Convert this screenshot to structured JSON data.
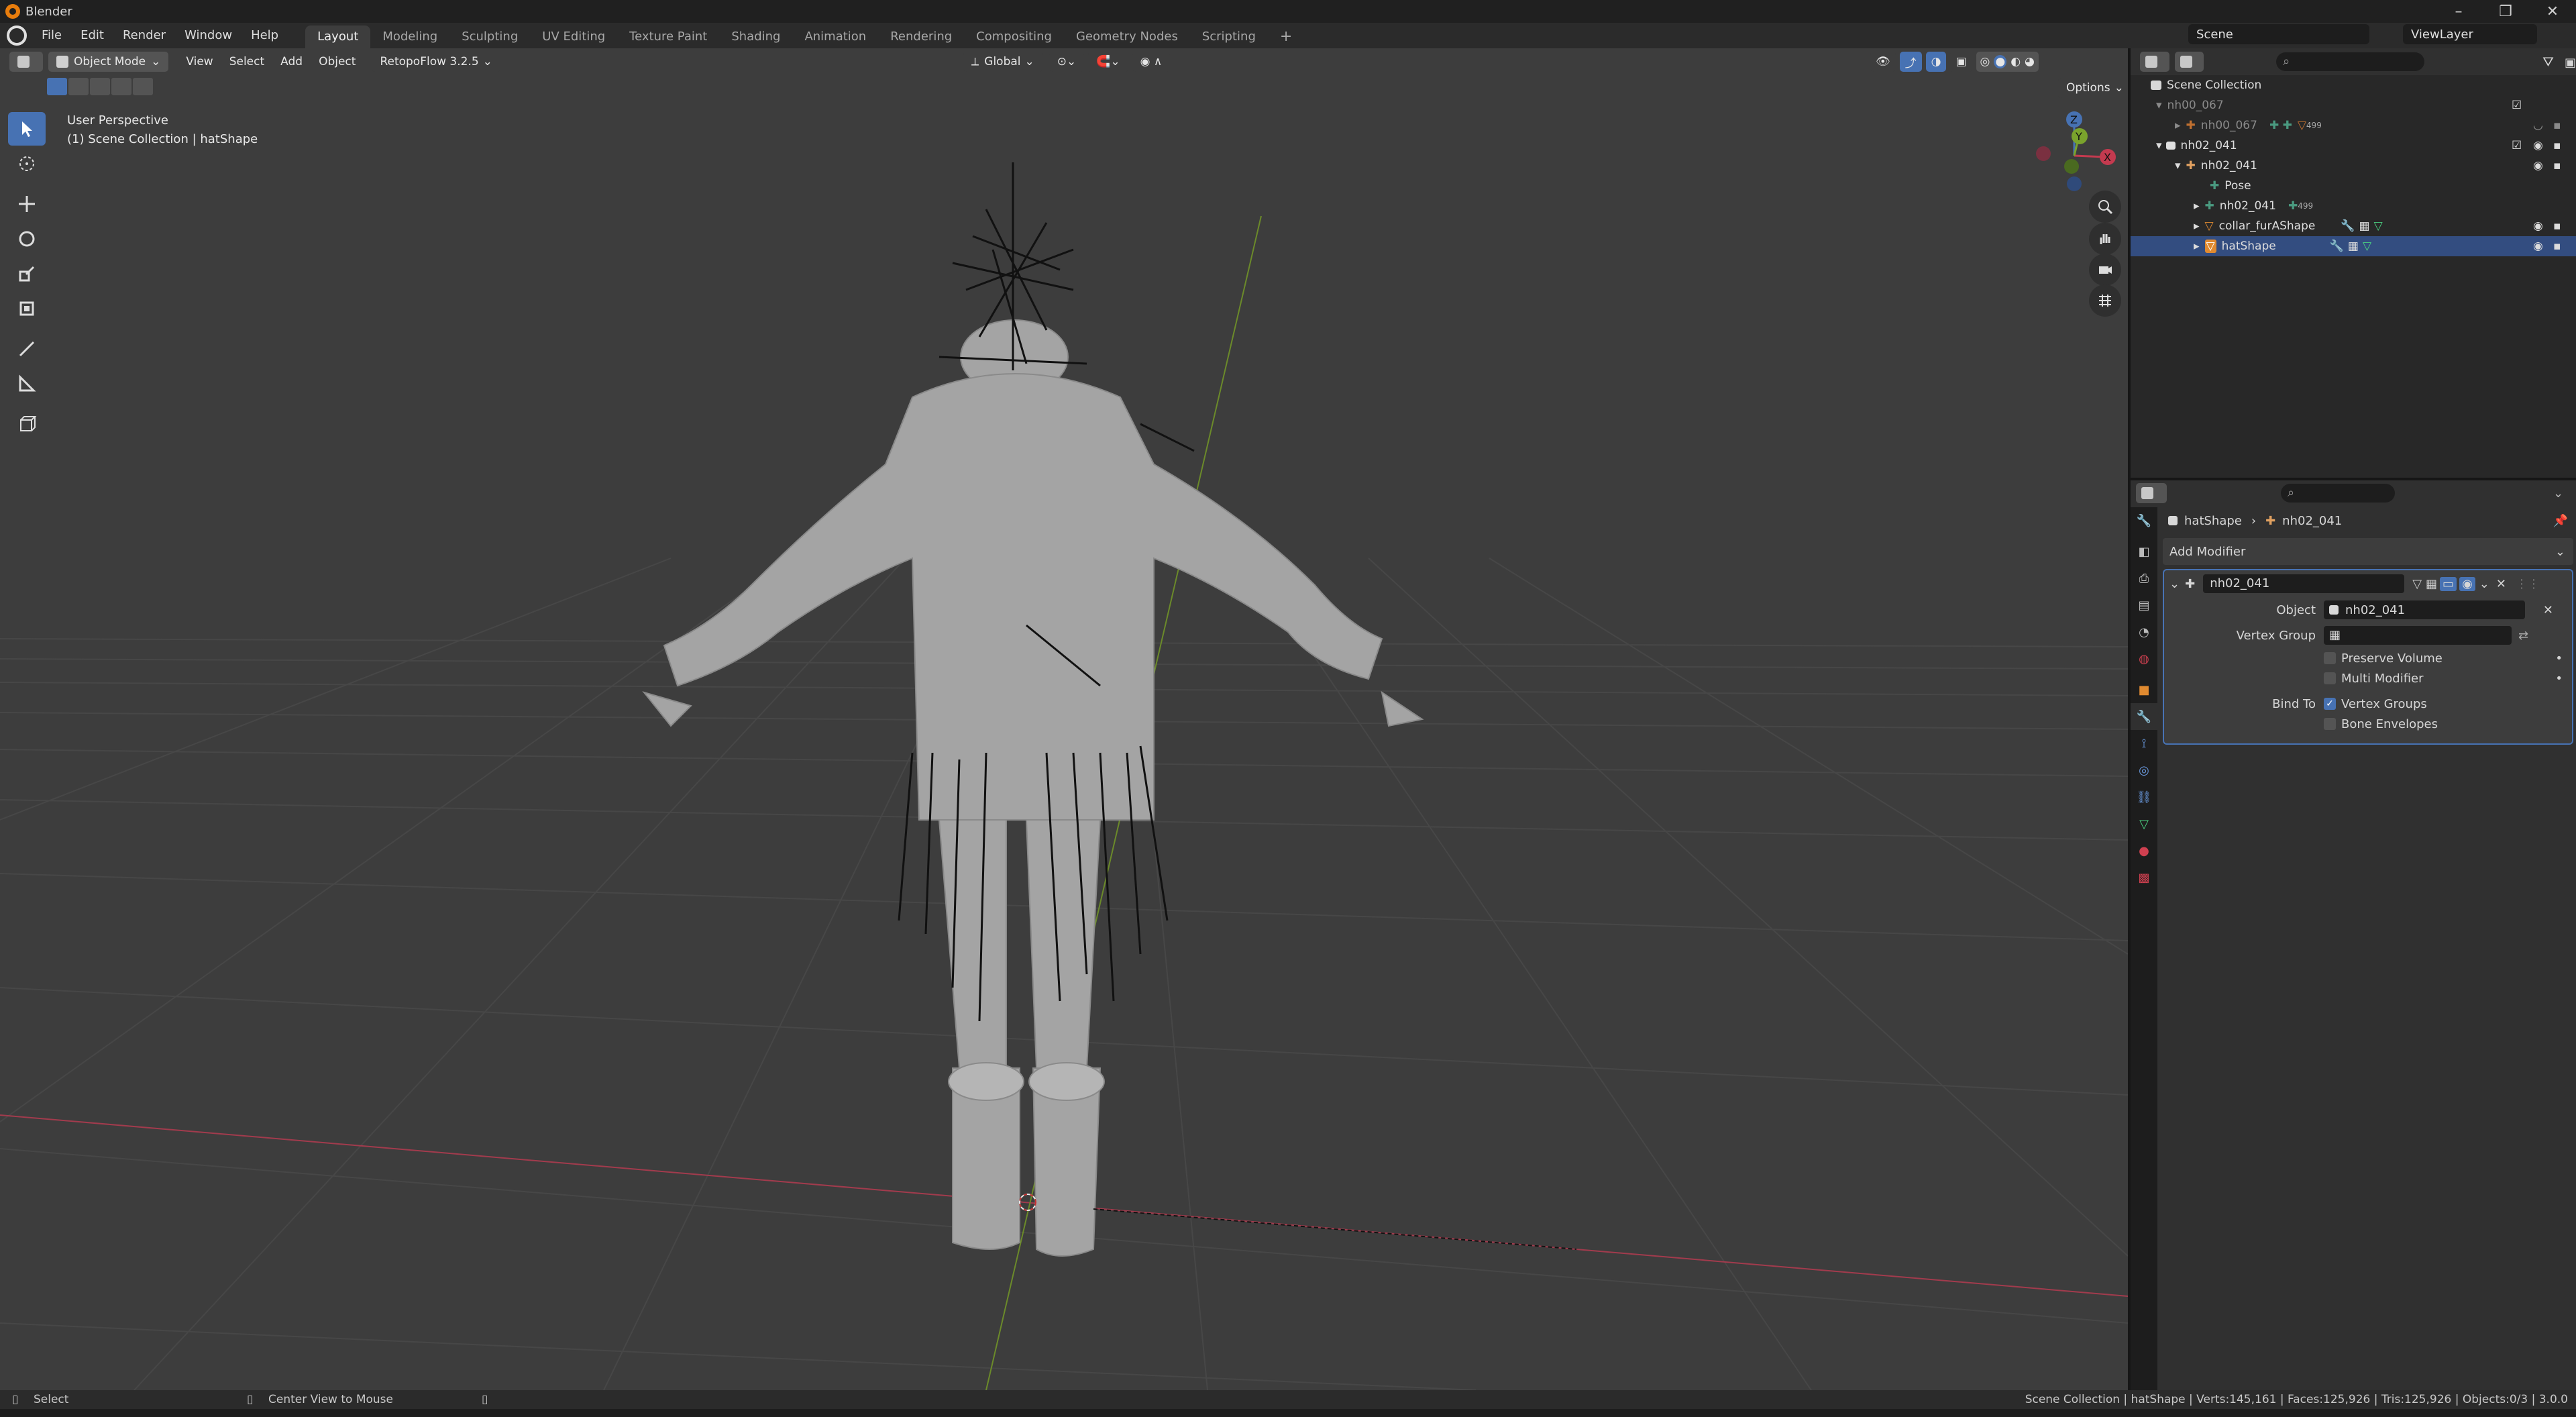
{
  "app": {
    "title": "Blender"
  },
  "menu": [
    "File",
    "Edit",
    "Render",
    "Window",
    "Help"
  ],
  "workspaces": [
    "Layout",
    "Modeling",
    "Sculpting",
    "UV Editing",
    "Texture Paint",
    "Shading",
    "Animation",
    "Rendering",
    "Compositing",
    "Geometry Nodes",
    "Scripting"
  ],
  "workspace_add": "+",
  "scene": {
    "name": "Scene",
    "viewlayer": "ViewLayer"
  },
  "viewport": {
    "mode": "Object Mode",
    "menus": [
      "View",
      "Select",
      "Add",
      "Object"
    ],
    "addon": "RetopoFlow 3.2.5",
    "orientation": "Global",
    "options": "Options",
    "overlay_line1": "User Perspective",
    "overlay_line2": "(1) Scene Collection | hatShape",
    "gizmo": {
      "z": "Z",
      "y": "Y",
      "x": "X"
    }
  },
  "outliner": {
    "root": "Scene Collection",
    "rows": [
      {
        "name": "nh00_067"
      },
      {
        "name": "nh00_067",
        "badge": "499"
      },
      {
        "name": "nh02_041"
      },
      {
        "name": "nh02_041"
      },
      {
        "name": "Pose"
      },
      {
        "name": "nh02_041",
        "badge": "499"
      },
      {
        "name": "collar_furAShape"
      },
      {
        "name": "hatShape"
      }
    ]
  },
  "properties": {
    "breadcrumb_object": "hatShape",
    "breadcrumb_data": "nh02_041",
    "add_modifier": "Add Modifier",
    "modifier_name": "nh02_041",
    "object_label": "Object",
    "object_value": "nh02_041",
    "vertex_group_label": "Vertex Group",
    "preserve_volume": "Preserve Volume",
    "multi_modifier": "Multi Modifier",
    "bind_to_label": "Bind To",
    "vertex_groups": "Vertex Groups",
    "bone_envelopes": "Bone Envelopes"
  },
  "statusbar": {
    "left": "Select",
    "middle": "Center View to Mouse",
    "right": "Scene Collection | hatShape | Verts:145,161 | Faces:125,926 | Tris:125,926 | Objects:0/3 | 3.0.0"
  },
  "colors": {
    "accent": "#4772b3",
    "viewport_bg": "#3d3d3d",
    "grid": "#4a4a4a",
    "axis_x": "#a23b4d",
    "axis_y": "#6b8a2a",
    "orange": "#e87d0d"
  }
}
